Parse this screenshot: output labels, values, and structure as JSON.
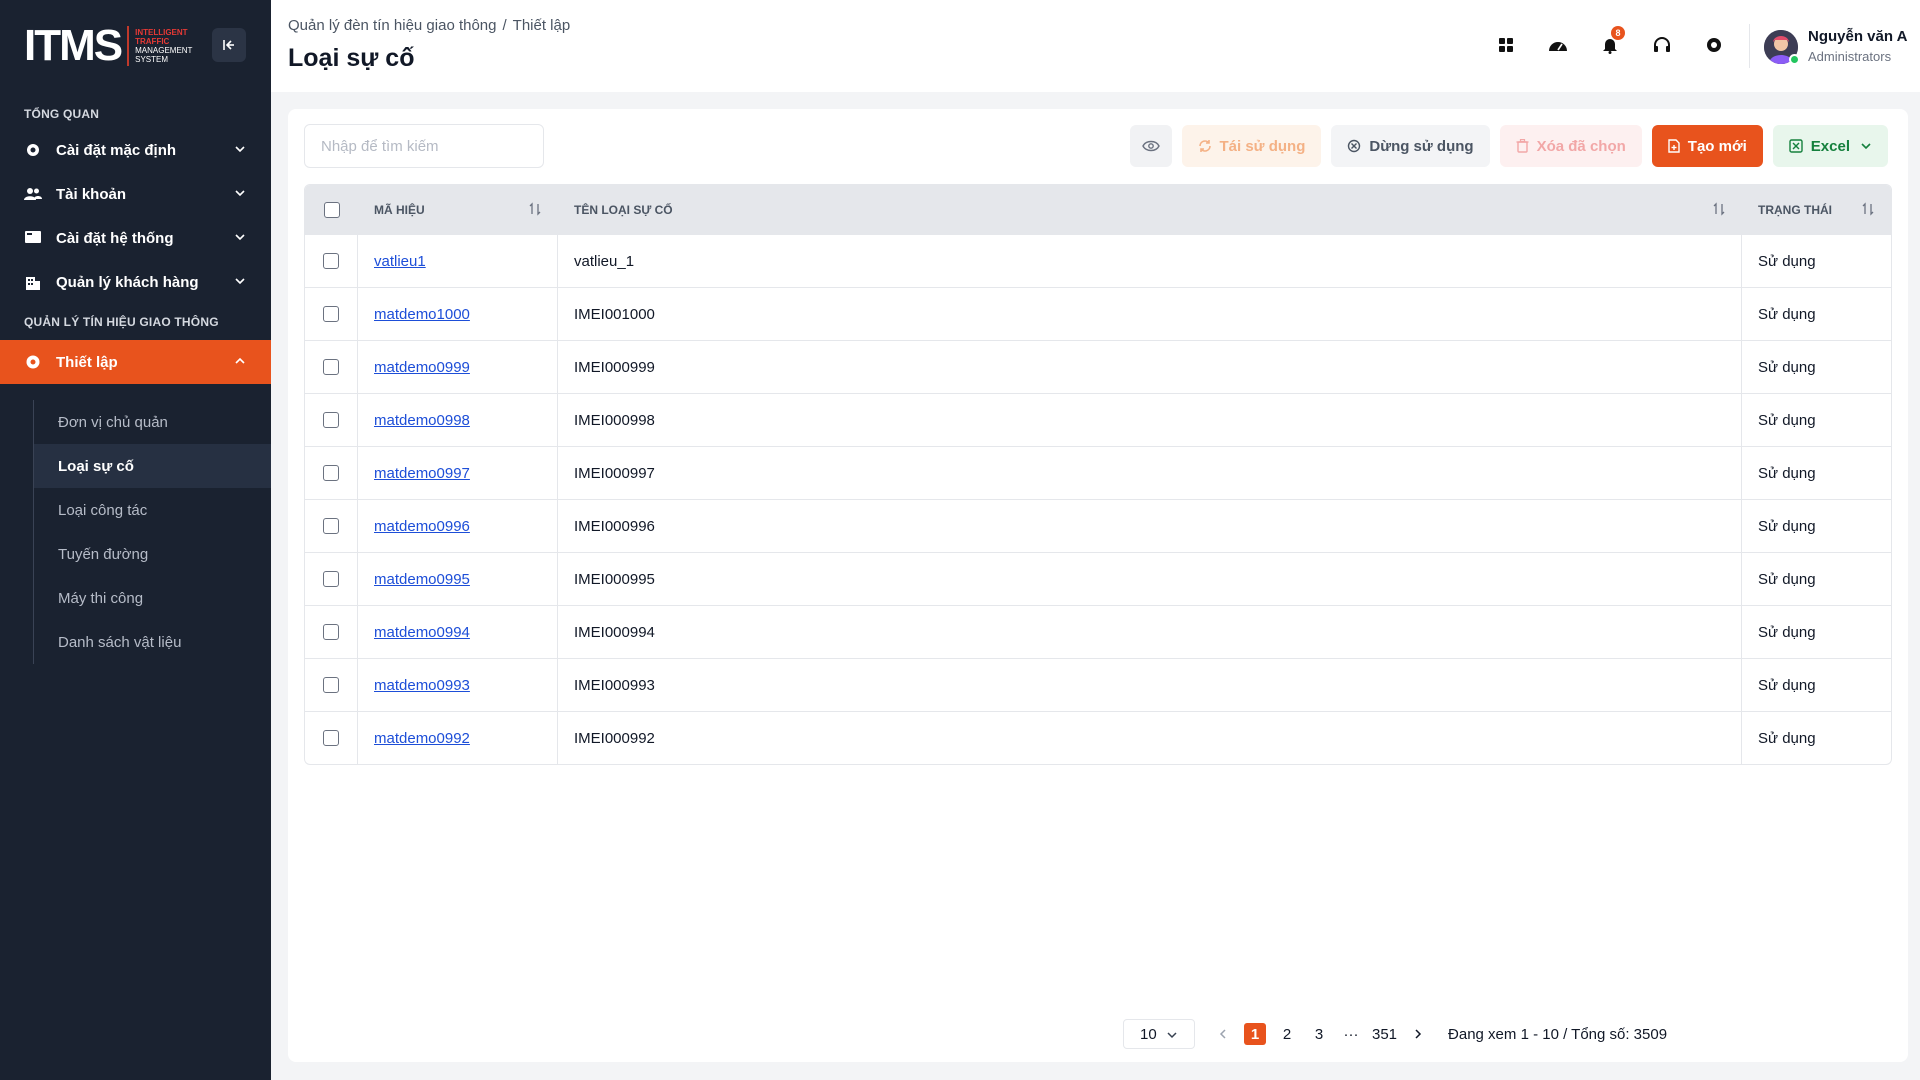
{
  "sidebar": {
    "logo_text": "ITMS",
    "logo_sub": [
      "INTELLIGENT",
      "TRAFFIC",
      "MANAGEMENT",
      "SYSTEM"
    ],
    "section_overview": "TỔNG QUAN",
    "section_traffic": "QUẢN LÝ TÍN HIỆU GIAO THÔNG",
    "items": [
      {
        "label": "Cài đặt mặc định",
        "icon": "gear-icon"
      },
      {
        "label": "Tài khoản",
        "icon": "users-icon"
      },
      {
        "label": "Cài đặt hệ thống",
        "icon": "monitor-icon"
      },
      {
        "label": "Quản lý khách hàng",
        "icon": "building-icon"
      },
      {
        "label": "Thiết lập",
        "icon": "settings-icon"
      }
    ],
    "subitems": [
      {
        "label": "Đơn vị chủ quản"
      },
      {
        "label": "Loại sự cố"
      },
      {
        "label": "Loại công tác"
      },
      {
        "label": "Tuyến đường"
      },
      {
        "label": "Máy thi công"
      },
      {
        "label": "Danh sách vật liệu"
      }
    ]
  },
  "header": {
    "breadcrumb": [
      "Quản lý đèn tín hiệu giao thông",
      "Thiết lập"
    ],
    "breadcrumb_sep": "/",
    "title": "Loại sự cố",
    "notification_count": "8",
    "user_name": "Nguyễn văn A",
    "user_role": "Administrators"
  },
  "toolbar": {
    "search_placeholder": "Nhập để tìm kiếm",
    "reuse": "Tái sử dụng",
    "stop": "Dừng sử dụng",
    "delete": "Xóa đã chọn",
    "create": "Tạo mới",
    "excel": "Excel"
  },
  "table": {
    "headers": {
      "code": "MÃ HIỆU",
      "name": "TÊN LOẠI SỰ CỐ",
      "status": "TRẠNG THÁI"
    },
    "rows": [
      {
        "code": "vatlieu1",
        "name": "vatlieu_1",
        "status": "Sử dụng"
      },
      {
        "code": "matdemo1000",
        "name": "IMEI001000",
        "status": "Sử dụng"
      },
      {
        "code": "matdemo0999",
        "name": "IMEI000999",
        "status": "Sử dụng"
      },
      {
        "code": "matdemo0998",
        "name": "IMEI000998",
        "status": "Sử dụng"
      },
      {
        "code": "matdemo0997",
        "name": "IMEI000997",
        "status": "Sử dụng"
      },
      {
        "code": "matdemo0996",
        "name": "IMEI000996",
        "status": "Sử dụng"
      },
      {
        "code": "matdemo0995",
        "name": "IMEI000995",
        "status": "Sử dụng"
      },
      {
        "code": "matdemo0994",
        "name": "IMEI000994",
        "status": "Sử dụng"
      },
      {
        "code": "matdemo0993",
        "name": "IMEI000993",
        "status": "Sử dụng"
      },
      {
        "code": "matdemo0992",
        "name": "IMEI000992",
        "status": "Sử dụng"
      }
    ]
  },
  "pagination": {
    "page_size": "10",
    "pages": [
      "1",
      "2",
      "3"
    ],
    "ellipsis": "···",
    "last_page": "351",
    "info": "Đang xem 1 - 10 / Tổng số: 3509"
  },
  "colors": {
    "accent": "#e8531d",
    "sidebar_bg": "#1a2230",
    "link": "#1d4ed8",
    "excel": "#15803d"
  }
}
